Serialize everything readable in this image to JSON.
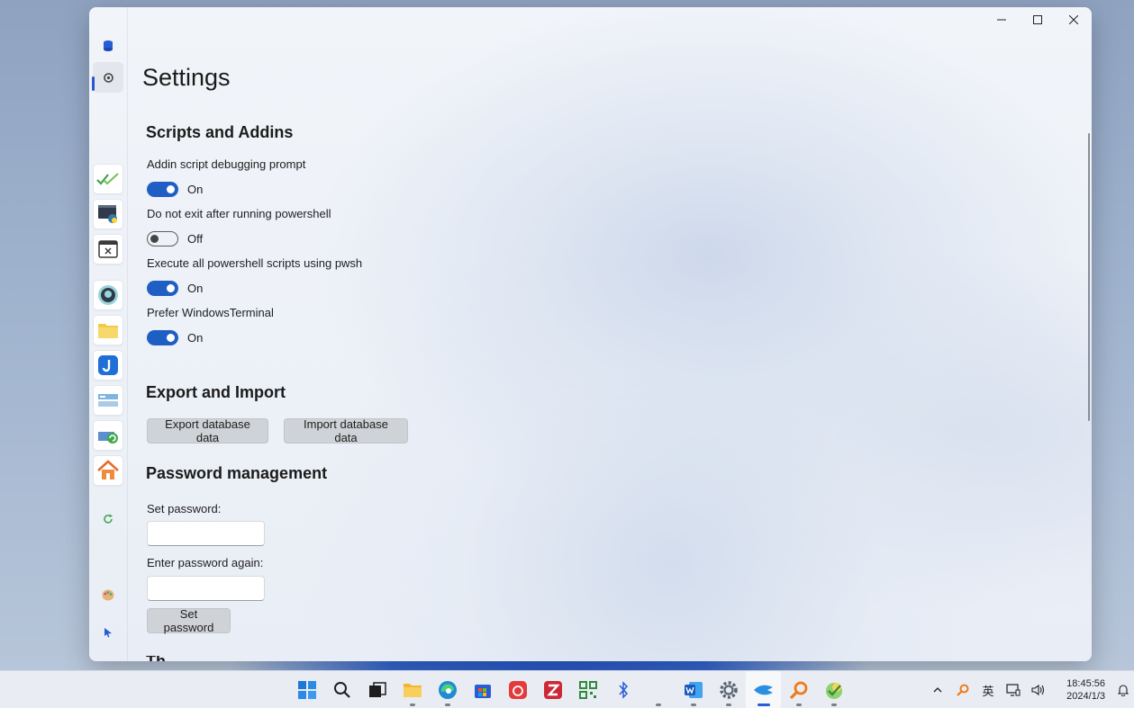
{
  "page": {
    "title": "Settings"
  },
  "window": {
    "minimize_glyph": "—",
    "maximize_glyph": "□",
    "close_glyph": "✕"
  },
  "sections": {
    "scripts": {
      "title": "Scripts and Addins",
      "settings": [
        {
          "label": "Addin script debugging prompt",
          "state": "On",
          "on": true
        },
        {
          "label": "Do not exit after running powershell",
          "state": "Off",
          "on": false
        },
        {
          "label": "Execute all powershell scripts using pwsh",
          "state": "On",
          "on": true
        },
        {
          "label": "Prefer WindowsTerminal",
          "state": "On",
          "on": true
        }
      ]
    },
    "export": {
      "title": "Export and Import",
      "export_label": "Export database data",
      "import_label": "Import database data"
    },
    "password": {
      "title": "Password management",
      "set_label": "Set password:",
      "again_label": "Enter password again:",
      "set_value": "",
      "again_value": "",
      "button_label": "Set password"
    },
    "next": {
      "title": "Th"
    }
  },
  "rail": {
    "icons": [
      "database-icon",
      "settings-icon",
      "checkmarks-icon",
      "terminal-python-icon",
      "window-x-icon",
      "github-icon",
      "folder-icon",
      "j-app-icon",
      "storage-icon",
      "refresh-drive-icon",
      "home-icon",
      "refresh-icon",
      "moon-icon",
      "palette-icon",
      "cursor-icon"
    ]
  },
  "taskbar": {
    "icons": [
      "start-icon",
      "search-icon",
      "task-view-icon",
      "file-explorer-icon",
      "edge-icon",
      "store-icon",
      "netease-music-icon",
      "zotero-icon",
      "qr-code-icon",
      "bluetooth-icon",
      "blank-icon",
      "word-icon",
      "settings-icon",
      "app-icon",
      "everything-search-icon",
      "puzzle-app-icon"
    ],
    "tray": {
      "chevron": "^",
      "ime": "英",
      "time": "18:45:56",
      "date": "2024/1/3"
    }
  },
  "colors": {
    "accent": "#1f5fc4",
    "indicator": "#2a5bd7",
    "button_bg": "#cfd2d6"
  }
}
